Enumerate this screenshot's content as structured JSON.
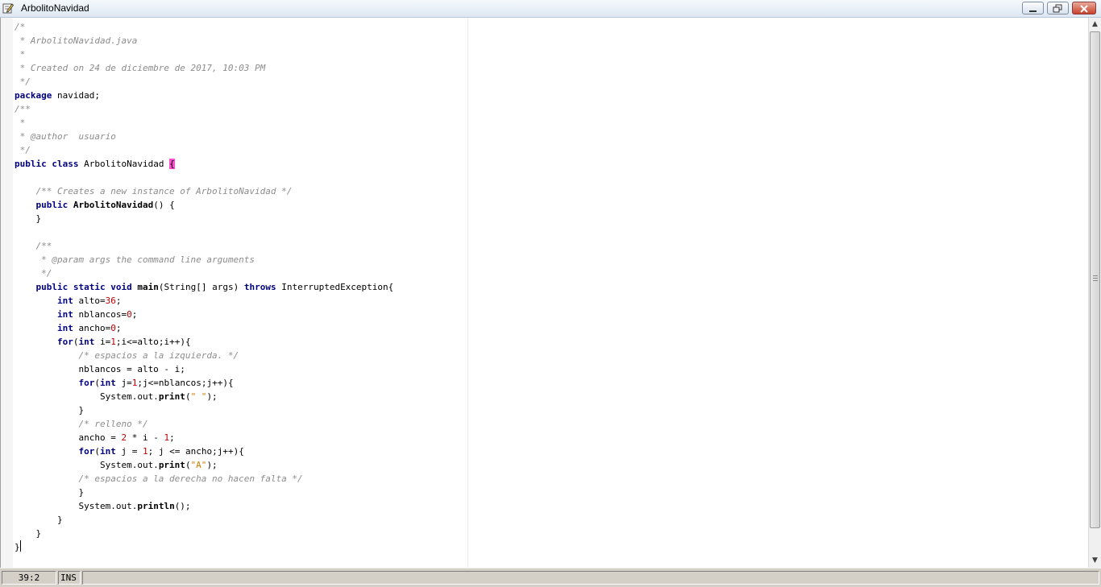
{
  "window": {
    "title": "ArbolitoNavidad"
  },
  "code_lines": [
    [
      {
        "t": "/*",
        "c": "cm"
      }
    ],
    [
      {
        "t": " * ArbolitoNavidad.java",
        "c": "cm"
      }
    ],
    [
      {
        "t": " *",
        "c": "cm"
      }
    ],
    [
      {
        "t": " * Created on 24 de diciembre de 2017, 10:03 PM",
        "c": "cm"
      }
    ],
    [
      {
        "t": " */",
        "c": "cm"
      }
    ],
    [
      {
        "t": "package",
        "c": "kw"
      },
      {
        "t": " navidad;",
        "c": ""
      }
    ],
    [
      {
        "t": "/**",
        "c": "cm"
      }
    ],
    [
      {
        "t": " *",
        "c": "cm"
      }
    ],
    [
      {
        "t": " * @author  usuario",
        "c": "cm"
      }
    ],
    [
      {
        "t": " */",
        "c": "cm"
      }
    ],
    [
      {
        "t": "public",
        "c": "kw"
      },
      {
        "t": " ",
        "c": ""
      },
      {
        "t": "class",
        "c": "kw"
      },
      {
        "t": " ArbolitoNavidad ",
        "c": ""
      },
      {
        "t": "{",
        "c": "hl"
      }
    ],
    [
      {
        "t": "",
        "c": ""
      }
    ],
    [
      {
        "t": "    /** Creates a new instance of ArbolitoNavidad */",
        "c": "cm"
      }
    ],
    [
      {
        "t": "    ",
        "c": ""
      },
      {
        "t": "public",
        "c": "kw"
      },
      {
        "t": " ",
        "c": ""
      },
      {
        "t": "ArbolitoNavidad",
        "c": "mt"
      },
      {
        "t": "() {",
        "c": ""
      }
    ],
    [
      {
        "t": "    }",
        "c": ""
      }
    ],
    [
      {
        "t": "",
        "c": ""
      }
    ],
    [
      {
        "t": "    /**",
        "c": "cm"
      }
    ],
    [
      {
        "t": "     * @param args the command line arguments",
        "c": "cm"
      }
    ],
    [
      {
        "t": "     */",
        "c": "cm"
      }
    ],
    [
      {
        "t": "    ",
        "c": ""
      },
      {
        "t": "public",
        "c": "kw"
      },
      {
        "t": " ",
        "c": ""
      },
      {
        "t": "static",
        "c": "kw"
      },
      {
        "t": " ",
        "c": ""
      },
      {
        "t": "void",
        "c": "kw"
      },
      {
        "t": " ",
        "c": ""
      },
      {
        "t": "main",
        "c": "mt"
      },
      {
        "t": "(String[] args) ",
        "c": ""
      },
      {
        "t": "throws",
        "c": "kw"
      },
      {
        "t": " InterruptedException{",
        "c": ""
      }
    ],
    [
      {
        "t": "        ",
        "c": ""
      },
      {
        "t": "int",
        "c": "kw"
      },
      {
        "t": " alto=",
        "c": ""
      },
      {
        "t": "36",
        "c": "num"
      },
      {
        "t": ";",
        "c": ""
      }
    ],
    [
      {
        "t": "        ",
        "c": ""
      },
      {
        "t": "int",
        "c": "kw"
      },
      {
        "t": " nblancos=",
        "c": ""
      },
      {
        "t": "0",
        "c": "num"
      },
      {
        "t": ";",
        "c": ""
      }
    ],
    [
      {
        "t": "        ",
        "c": ""
      },
      {
        "t": "int",
        "c": "kw"
      },
      {
        "t": " ancho=",
        "c": ""
      },
      {
        "t": "0",
        "c": "num"
      },
      {
        "t": ";",
        "c": ""
      }
    ],
    [
      {
        "t": "        ",
        "c": ""
      },
      {
        "t": "for",
        "c": "kw"
      },
      {
        "t": "(",
        "c": ""
      },
      {
        "t": "int",
        "c": "kw"
      },
      {
        "t": " i=",
        "c": ""
      },
      {
        "t": "1",
        "c": "num"
      },
      {
        "t": ";i<=alto;i++){",
        "c": ""
      }
    ],
    [
      {
        "t": "            /* espacios a la izquierda. */",
        "c": "cm"
      }
    ],
    [
      {
        "t": "            nblancos = alto - i;",
        "c": ""
      }
    ],
    [
      {
        "t": "            ",
        "c": ""
      },
      {
        "t": "for",
        "c": "kw"
      },
      {
        "t": "(",
        "c": ""
      },
      {
        "t": "int",
        "c": "kw"
      },
      {
        "t": " j=",
        "c": ""
      },
      {
        "t": "1",
        "c": "num"
      },
      {
        "t": ";j<=nblancos;j++){",
        "c": ""
      }
    ],
    [
      {
        "t": "                System.out.",
        "c": ""
      },
      {
        "t": "print",
        "c": "mt"
      },
      {
        "t": "(",
        "c": ""
      },
      {
        "t": "\" \"",
        "c": "str"
      },
      {
        "t": ");",
        "c": ""
      }
    ],
    [
      {
        "t": "            }",
        "c": ""
      }
    ],
    [
      {
        "t": "            /* relleno */",
        "c": "cm"
      }
    ],
    [
      {
        "t": "            ancho = ",
        "c": ""
      },
      {
        "t": "2",
        "c": "num"
      },
      {
        "t": " * i - ",
        "c": ""
      },
      {
        "t": "1",
        "c": "num"
      },
      {
        "t": ";",
        "c": ""
      }
    ],
    [
      {
        "t": "            ",
        "c": ""
      },
      {
        "t": "for",
        "c": "kw"
      },
      {
        "t": "(",
        "c": ""
      },
      {
        "t": "int",
        "c": "kw"
      },
      {
        "t": " j = ",
        "c": ""
      },
      {
        "t": "1",
        "c": "num"
      },
      {
        "t": "; j <= ancho;j++){",
        "c": ""
      }
    ],
    [
      {
        "t": "                System.out.",
        "c": ""
      },
      {
        "t": "print",
        "c": "mt"
      },
      {
        "t": "(",
        "c": ""
      },
      {
        "t": "\"A\"",
        "c": "str"
      },
      {
        "t": ");",
        "c": ""
      }
    ],
    [
      {
        "t": "            /* espacios a la derecha no hacen falta */",
        "c": "cm"
      }
    ],
    [
      {
        "t": "            }",
        "c": ""
      }
    ],
    [
      {
        "t": "            System.out.",
        "c": ""
      },
      {
        "t": "println",
        "c": "mt"
      },
      {
        "t": "();",
        "c": ""
      }
    ],
    [
      {
        "t": "        }",
        "c": ""
      }
    ],
    [
      {
        "t": "    }",
        "c": ""
      }
    ],
    [
      {
        "t": "}",
        "c": ""
      },
      {
        "t": "",
        "c": "caret"
      }
    ]
  ],
  "status": {
    "position": "39:2",
    "mode": "INS"
  },
  "colors": {
    "keyword": "#000080",
    "comment": "#8c8c8c",
    "number": "#c00000",
    "string": "#ce7b00",
    "brace_highlight": "#ff4dd2"
  }
}
